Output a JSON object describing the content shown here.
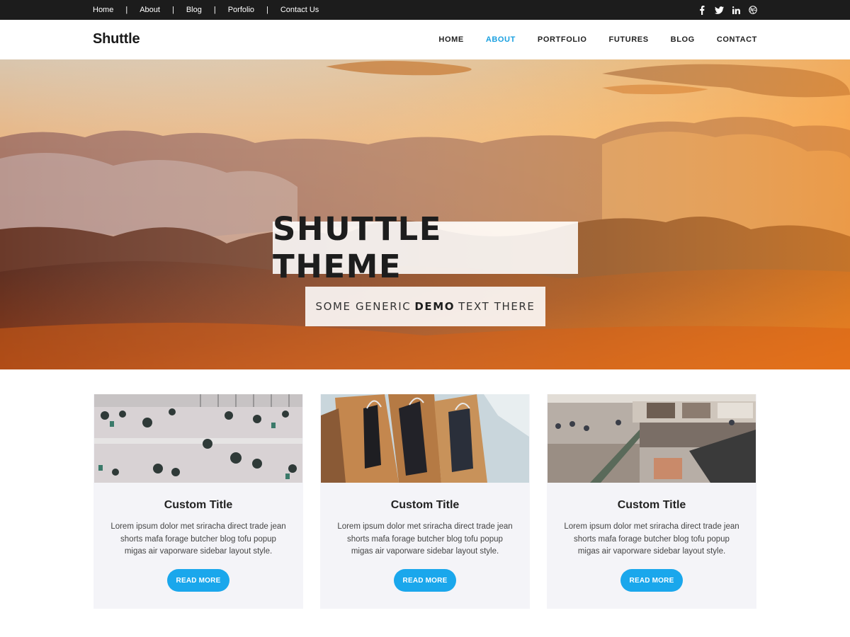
{
  "topbar": {
    "links": [
      "Home",
      "About",
      "Blog",
      "Porfolio",
      "Contact Us"
    ],
    "separator": "|",
    "socials": [
      "facebook-icon",
      "twitter-icon",
      "linkedin-icon",
      "dribbble-icon"
    ]
  },
  "header": {
    "logo": "Shuttle",
    "nav": [
      "HOME",
      "ABOUT",
      "PORTFOLIO",
      "FUTURES",
      "BLOG",
      "CONTACT"
    ],
    "active_nav": "ABOUT"
  },
  "hero": {
    "title": "SHUTTLE THEME",
    "sub_before": "SOME GENERIC",
    "sub_bold": "DEMO",
    "sub_after": "TEXT THERE"
  },
  "cards": [
    {
      "title": "Custom Title",
      "text": "Lorem ipsum dolor met sriracha direct trade jean shorts mafa forage butcher blog tofu popup migas air vaporware sidebar layout style.",
      "button": "READ MORE"
    },
    {
      "title": "Custom Title",
      "text": "Lorem ipsum dolor met sriracha direct trade jean shorts mafa forage butcher blog tofu popup migas air vaporware sidebar layout style.",
      "button": "READ MORE"
    },
    {
      "title": "Custom Title",
      "text": "Lorem ipsum dolor met sriracha direct trade jean shorts mafa forage butcher blog tofu popup migas air vaporware sidebar layout style.",
      "button": "READ MORE"
    }
  ],
  "colors": {
    "accent": "#1aa7ec",
    "topbar": "#1c1c1c",
    "card_bg": "#f4f4f8"
  }
}
